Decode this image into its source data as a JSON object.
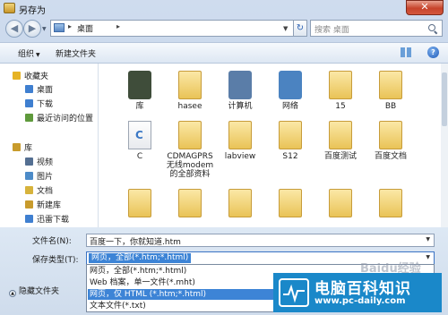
{
  "window": {
    "title": "另存为",
    "close_glyph": "✕"
  },
  "nav": {
    "back_glyph": "◀",
    "forward_glyph": "▶",
    "drop_glyph": "▼",
    "address": {
      "separator": "▸",
      "location": "桌面",
      "chevron": "▸",
      "drop_glyph": "▼"
    },
    "refresh_glyph": "↻",
    "search_placeholder": "搜索 桌面"
  },
  "toolbar": {
    "organize": "组织",
    "new_folder": "新建文件夹",
    "caret": "▼",
    "help": "?"
  },
  "sidebar": {
    "items": [
      {
        "label": "收藏夹",
        "icon": "star-icon",
        "color": "#e6b325",
        "level": 0
      },
      {
        "label": "桌面",
        "icon": "desktop-icon",
        "color": "#3f7fd0",
        "level": 1
      },
      {
        "label": "下载",
        "icon": "download-icon",
        "color": "#3f7fd0",
        "level": 1
      },
      {
        "label": "最近访问的位置",
        "icon": "recent-icon",
        "color": "#5f9a3c",
        "level": 1
      },
      {
        "label": "库",
        "icon": "library-icon",
        "color": "#c89b2c",
        "level": 0
      },
      {
        "label": "视频",
        "icon": "video-icon",
        "color": "#546f92",
        "level": 1
      },
      {
        "label": "图片",
        "icon": "pictures-icon",
        "color": "#4c8bc8",
        "level": 1
      },
      {
        "label": "文档",
        "icon": "documents-icon",
        "color": "#d7b33c",
        "level": 1
      },
      {
        "label": "新建库",
        "icon": "library-icon",
        "color": "#c89b2c",
        "level": 1
      },
      {
        "label": "迅雷下载",
        "icon": "download-icon",
        "color": "#3f7fd0",
        "level": 1
      }
    ]
  },
  "files": [
    {
      "name": "库",
      "icon": "library-icon",
      "color": "#3f4d3a"
    },
    {
      "name": "hasee",
      "icon": "user-folder-icon",
      "color": "#4f9a45"
    },
    {
      "name": "计算机",
      "icon": "computer-icon",
      "color": "#5a7da8"
    },
    {
      "name": "网络",
      "icon": "network-icon",
      "color": "#4b83c1"
    },
    {
      "name": "15",
      "icon": "folder-icon",
      "color": "#e9c357"
    },
    {
      "name": "BB",
      "icon": "folder-icon",
      "color": "#e9c357"
    },
    {
      "name": "C",
      "icon": "document-icon",
      "color": "#3b78c5"
    },
    {
      "name": "CDMAGPRS无线modem的全部资料",
      "icon": "folder-icon",
      "color": "#e9c357"
    },
    {
      "name": "labview",
      "icon": "folder-icon",
      "color": "#e9c357"
    },
    {
      "name": "S12",
      "icon": "folder-icon",
      "color": "#e9c357"
    },
    {
      "name": "百度测试",
      "icon": "folder-icon",
      "color": "#e9c357"
    },
    {
      "name": "百度文档",
      "icon": "folder-icon",
      "color": "#e9c357"
    },
    {
      "name": "",
      "icon": "folder-icon",
      "color": "#e9c357"
    },
    {
      "name": "",
      "icon": "folder-icon",
      "color": "#e9c357"
    },
    {
      "name": "",
      "icon": "image-folder-icon",
      "color": "#e9c357"
    },
    {
      "name": "",
      "icon": "folder-icon",
      "color": "#e9c357"
    },
    {
      "name": "",
      "icon": "folder-icon",
      "color": "#e9c357"
    },
    {
      "name": "",
      "icon": "folder-icon",
      "color": "#e9c357"
    }
  ],
  "save": {
    "filename_label": "文件名(N):",
    "filename_value": "百度一下，你就知道.htm",
    "type_label": "保存类型(T):",
    "type_value": "网页，全部(*.htm;*.html)",
    "type_options": [
      "网页，全部(*.htm;*.html)",
      "Web 档案，单一文件(*.mht)",
      "网页，仅 HTML (*.htm;*.html)",
      "文本文件(*.txt)"
    ],
    "highlighted_option_index": 2,
    "hide_folders": "隐藏文件夹"
  },
  "watermark": {
    "brand": "电脑百科知识",
    "site": "www.pc-daily.com",
    "baidu": "Baidu经验"
  }
}
